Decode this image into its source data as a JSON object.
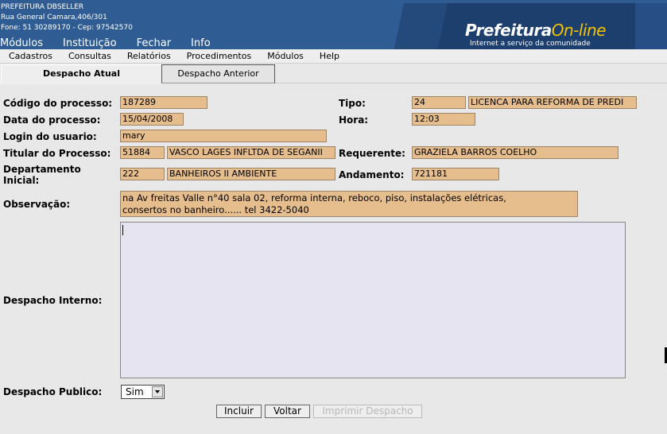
{
  "header": {
    "org_name": "PREFEITURA DBSELLER",
    "address": "Rua General Camara,406/301",
    "contact": "Fone: 51 30289170  -  Cep: 97542570",
    "logo_main": "Prefeitura",
    "logo_accent": "On-line",
    "tagline": "Internet a serviço da comunidade",
    "menu": [
      "Módulos",
      "Instituição",
      "Fechar",
      "Info"
    ]
  },
  "submenu": [
    "Cadastros",
    "Consultas",
    "Relatórios",
    "Procedimentos",
    "Módulos",
    "Help"
  ],
  "tabs": {
    "active": "Despacho Atual",
    "inactive": "Despacho Anterior"
  },
  "form": {
    "codigo_label": "Código do processo:",
    "codigo_value": "187289",
    "tipo_label": "Tipo:",
    "tipo_code": "24",
    "tipo_desc": "LICENCA PARA REFORMA DE PREDI",
    "data_label": "Data do processo:",
    "data_value": "15/04/2008",
    "hora_label": "Hora:",
    "hora_value": "12:03",
    "login_label": "Login do usuario:",
    "login_value": "mary",
    "titular_label": "Titular do Processo:",
    "titular_code": "51884",
    "titular_name": "VASCO LAGES INFLTDA DE SEGANII",
    "requerente_label": "Requerente:",
    "requerente_value": "GRAZIELA BARROS COELHO",
    "depto_label_1": "Departamento",
    "depto_label_2": "Inicial:",
    "depto_code": "222",
    "depto_name": "BANHEIROS II AMBIENTE",
    "andamento_label": "Andamento:",
    "andamento_value": "721181",
    "obs_label": "Observação:",
    "obs_line1": "na Av freitas Valle n°40 sala 02, reforma interna, reboco, piso, instalações elétricas,",
    "obs_line2": "consertos no banheiro...... tel 3422-5040",
    "despacho_interno_label": "Despacho Interno:",
    "despacho_interno_value": "",
    "despacho_publico_label": "Despacho Publico:",
    "despacho_publico_value": "Sim"
  },
  "buttons": {
    "incluir": "Incluir",
    "voltar": "Voltar",
    "imprimir": "Imprimir Despacho"
  },
  "colors": {
    "header_bg": "#2f5d93",
    "field_bg": "#e6bd8c",
    "textarea_bg": "#e6e4f0",
    "logo_accent": "#f5c400"
  }
}
